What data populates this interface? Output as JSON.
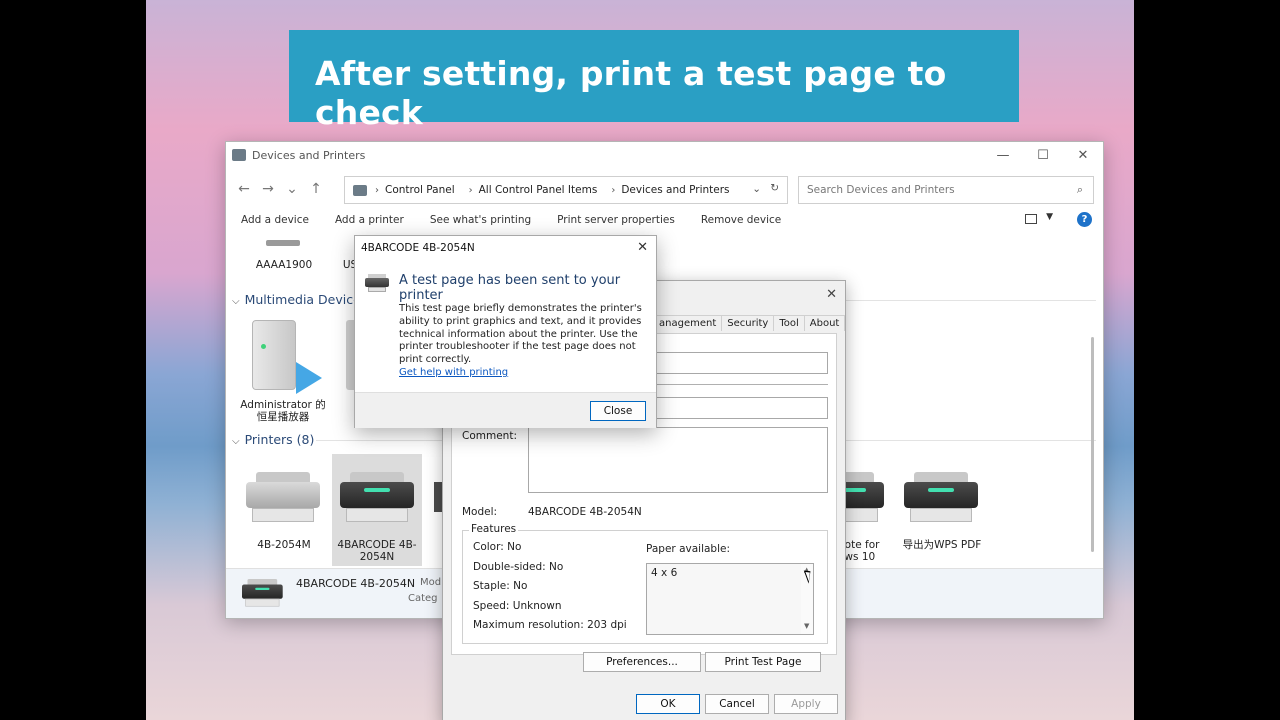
{
  "banner": {
    "text": "After setting, print a test page to check"
  },
  "window": {
    "title": "Devices and Printers",
    "controls": {
      "minimize": "—",
      "maximize": "☐",
      "close": "✕"
    },
    "nav": {
      "back": "←",
      "forward": "→",
      "recent": "⌄",
      "up": "↑"
    },
    "breadcrumb": [
      "Control Panel",
      "All Control Panel Items",
      "Devices and Printers"
    ],
    "search_placeholder": "Search Devices and Printers",
    "commands": [
      "Add a device",
      "Add a printer",
      "See what's printing",
      "Print server properties",
      "Remove device"
    ],
    "devices_top": [
      {
        "label": "AAAA1900"
      },
      {
        "label": "US"
      }
    ],
    "groups": {
      "multimedia": "Multimedia Devices",
      "printers": "Printers (8)"
    },
    "multimedia_items": [
      {
        "label": "Administrator 的 恒星播放器"
      }
    ],
    "printers": [
      {
        "label": "4B-2054M"
      },
      {
        "label": "4BARCODE 4B-2054N"
      },
      {
        "label": "note for ows 10"
      },
      {
        "label": "导出为WPS PDF"
      }
    ],
    "details": {
      "name": "4BARCODE 4B-2054N",
      "k1": "Mod",
      "k2": "Categ"
    }
  },
  "props": {
    "tabs": [
      "anagement",
      "Security",
      "Tool",
      "About"
    ],
    "comment_label": "Comment:",
    "model_label": "Model:",
    "model_value": "4BARCODE 4B-2054N",
    "features_legend": "Features",
    "features": [
      "Color: No",
      "Double-sided: No",
      "Staple: No",
      "Speed: Unknown",
      "Maximum resolution: 203 dpi"
    ],
    "paper_label": "Paper available:",
    "paper_value": "4 x 6",
    "preferences_btn": "Preferences...",
    "print_test_btn": "Print Test Page",
    "ok_btn": "OK",
    "cancel_btn": "Cancel",
    "apply_btn": "Apply"
  },
  "msg": {
    "title": "4BARCODE 4B-2054N",
    "heading": "A test page has been sent to your printer",
    "body": "This test page briefly demonstrates the printer's ability to print graphics and text, and it provides technical information about the printer. Use the printer troubleshooter if the test page does not print correctly.",
    "link": "Get help with printing",
    "close_btn": "Close"
  },
  "colors": {
    "banner": "#2a9fc4",
    "link": "#0b57c0",
    "heading": "#1f3f6b",
    "group": "#2b4a77",
    "help": "#1e72c9"
  }
}
